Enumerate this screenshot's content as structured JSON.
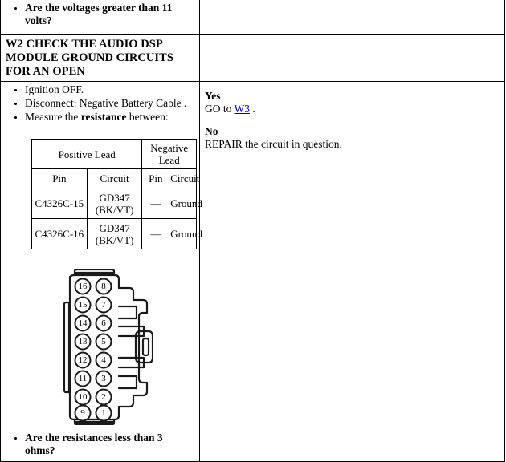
{
  "document": {
    "type": "diagnostic-pinpoint-test",
    "colors": {
      "link": "#0000CC",
      "border": "#000000",
      "text": "#000000",
      "background": "#FFFFFF"
    }
  },
  "top_row": {
    "questions": [
      "Are the voltages greater than 11 volts?"
    ]
  },
  "step": {
    "id": "W2",
    "header": "W2 CHECK THE AUDIO DSP MODULE GROUND CIRCUITS FOR AN OPEN",
    "actions": [
      "Ignition OFF.",
      "Disconnect: Negative Battery Cable .",
      "Measure the resistance between:"
    ],
    "action_parts": [
      {
        "plain": "Ignition OFF."
      },
      {
        "plain": "Disconnect: Negative Battery Cable ."
      },
      {
        "pre": "Measure the ",
        "bold": "resistance",
        "post": " between:"
      }
    ],
    "question": "Are the resistances less than 3 ohms?"
  },
  "measurement_table": {
    "group_headers": [
      "Positive Lead",
      "Negative Lead"
    ],
    "sub_headers": [
      "Pin",
      "Circuit",
      "Pin",
      "Circuit"
    ],
    "rows": [
      {
        "positive_pin": "C4326C-15",
        "positive_circuit": "GD347 (BK/VT)",
        "negative_pin": "—",
        "negative_circuit": "Ground"
      },
      {
        "positive_pin": "C4326C-16",
        "positive_circuit": "GD347 (BK/VT)",
        "negative_pin": "—",
        "negative_circuit": "Ground"
      }
    ]
  },
  "connector": {
    "name": "C4326C",
    "pin_count": 16,
    "left_column_pins": [
      "16",
      "15",
      "14",
      "13",
      "12",
      "11",
      "10",
      "9"
    ],
    "right_column_pins": [
      "8",
      "7",
      "6",
      "5",
      "4",
      "3",
      "2",
      "1"
    ]
  },
  "results": {
    "yes_label": "Yes",
    "yes_pre": "GO to ",
    "yes_link": "W3",
    "yes_post": " .",
    "no_label": "No",
    "no_text": "REPAIR the circuit in question."
  }
}
